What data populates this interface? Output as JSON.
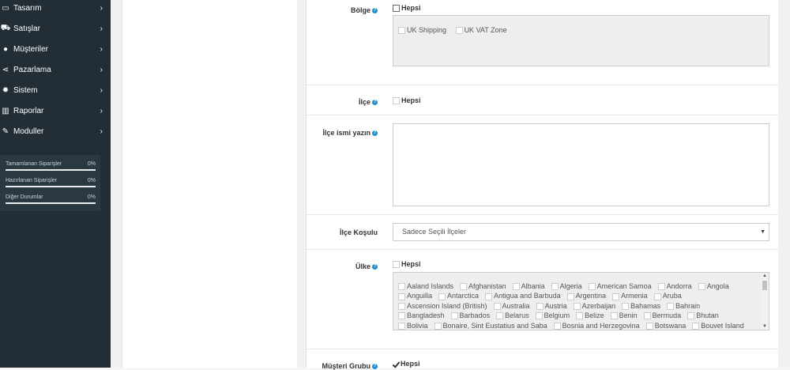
{
  "sidebar": {
    "items": [
      {
        "label": "Tasarım",
        "icon": "monitor-icon"
      },
      {
        "label": "Satışlar",
        "icon": "cart-icon"
      },
      {
        "label": "Müşteriler",
        "icon": "user-icon"
      },
      {
        "label": "Pazarlama",
        "icon": "share-icon"
      },
      {
        "label": "Sistem",
        "icon": "gear-icon"
      },
      {
        "label": "Raporlar",
        "icon": "bar-chart-icon"
      },
      {
        "label": "Moduller",
        "icon": "plug-icon"
      }
    ],
    "stats": [
      {
        "label": "Tamamlanan Siparişler",
        "value": "0%",
        "progress": 0
      },
      {
        "label": "Hazırlanan Siparişler",
        "value": "0%",
        "progress": 0
      },
      {
        "label": "Diğer Durumlar",
        "value": "0%",
        "progress": 0
      }
    ]
  },
  "form": {
    "region": {
      "label": "Bölge",
      "all_label": "Hepsi",
      "options": [
        "UK Shipping",
        "UK VAT Zone"
      ]
    },
    "district": {
      "label": "İlçe",
      "all_label": "Hepsi"
    },
    "district_name": {
      "label": "İlçe ismi yazın",
      "value": ""
    },
    "district_condition": {
      "label": "İlçe Koşulu",
      "selected": "Sadece Seçili İlçeler"
    },
    "country": {
      "label": "Ülke",
      "all_label": "Hepsi",
      "options": [
        "Aaland Islands",
        "Afghanistan",
        "Albania",
        "Algeria",
        "American Samoa",
        "Andorra",
        "Angola",
        "Anguilla",
        "Antarctica",
        "Antigua and Barbuda",
        "Argentina",
        "Armenia",
        "Aruba",
        "Ascension Island (British)",
        "Australia",
        "Austria",
        "Azerbaijan",
        "Bahamas",
        "Bahrain",
        "Bangladesh",
        "Barbados",
        "Belarus",
        "Belgium",
        "Belize",
        "Benin",
        "Bermuda",
        "Bhutan",
        "Bolivia",
        "Bonaire, Sint Eustatius and Saba",
        "Bosnia and Herzegovina",
        "Botswana",
        "Bouvet Island"
      ]
    },
    "customer_group": {
      "label": "Müşteri Grubu",
      "all_label": "Hepsi"
    }
  },
  "colors": {
    "sidebar_bg": "#222d35",
    "accent": "#1e91cf"
  }
}
